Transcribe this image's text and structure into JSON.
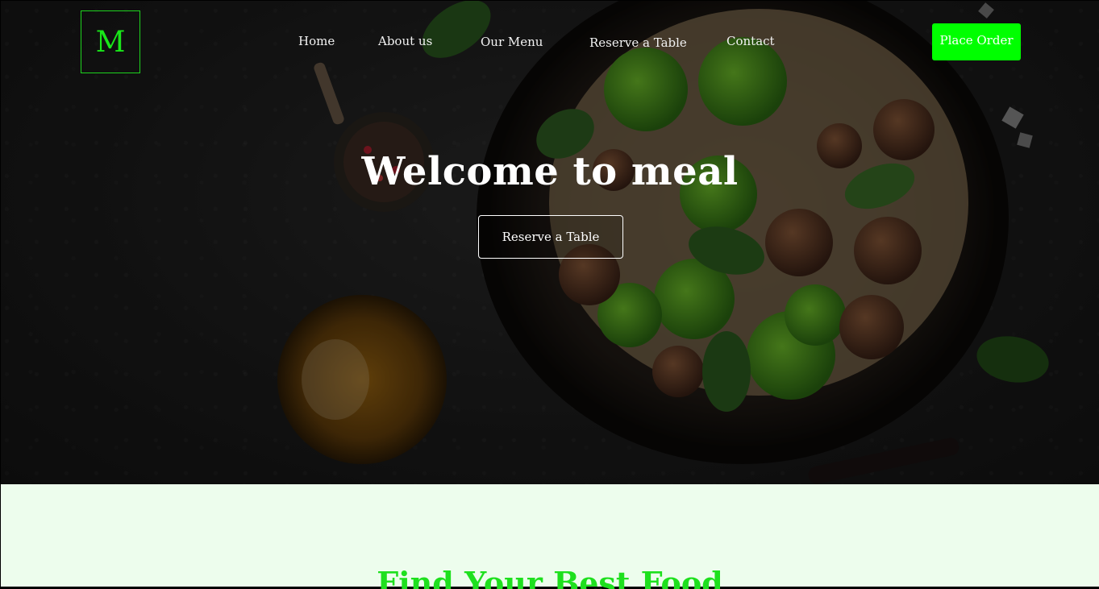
{
  "brand": {
    "logo_letter": "M",
    "accent_color": "#00ff00"
  },
  "nav": {
    "items": [
      {
        "label": "Home"
      },
      {
        "label": "About us"
      },
      {
        "label": "Our Menu"
      },
      {
        "label": "Reserve a Table"
      },
      {
        "label": "Contact"
      }
    ],
    "cta_label": "Place Order"
  },
  "hero": {
    "title": "Welcome to meal",
    "button_label": "Reserve a Table",
    "background_image": "dark-food-bowl-photo"
  },
  "section": {
    "title": "Find Your Best Food",
    "background_color": "#edfded"
  }
}
